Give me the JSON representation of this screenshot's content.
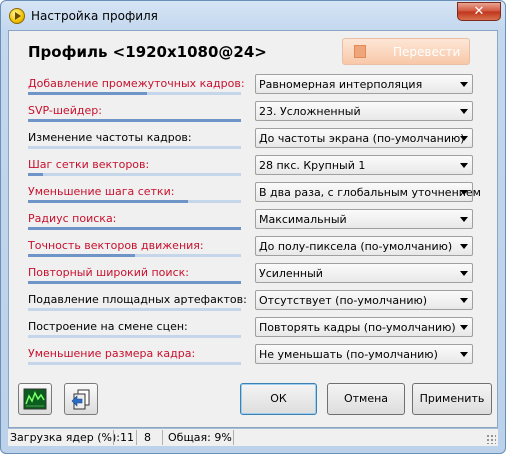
{
  "window": {
    "title": "Настройка профиля",
    "close_label": "✕"
  },
  "header": {
    "title": "Профиль <1920x1080@24>",
    "translate_label": "Перевести"
  },
  "settings": [
    {
      "label": "Добавление промежуточных кадров:",
      "value": "Равномерная интерполяция",
      "label_color": "red",
      "level": 0.56
    },
    {
      "label": "SVP-шейдер:",
      "value": "23. Усложненный",
      "label_color": "red",
      "level": 1.0
    },
    {
      "label": "Изменение частоты кадров:",
      "value": "До частоты экрана (по-умолчанию)",
      "label_color": "black",
      "level": 0.0
    },
    {
      "label": "Шаг сетки векторов:",
      "value": "28 пкс. Крупный 1",
      "label_color": "red",
      "level": 0.07
    },
    {
      "label": "Уменьшение шага сетки:",
      "value": "В два раза, с глобальным уточнением",
      "label_color": "red",
      "level": 0.75
    },
    {
      "label": "Радиус поиска:",
      "value": "Максимальный",
      "label_color": "red",
      "level": 1.0
    },
    {
      "label": "Точность векторов движения:",
      "value": "До полу-пиксела (по-умолчанию)",
      "label_color": "red",
      "level": 0.5
    },
    {
      "label": "Повторный широкий поиск:",
      "value": "Усиленный",
      "label_color": "red",
      "level": 1.0
    },
    {
      "label": "Подавление площадных артефактов:",
      "value": "Отсутствует (по-умолчанию)",
      "label_color": "black",
      "level": 0.0
    },
    {
      "label": "Построение на смене сцен:",
      "value": "Повторять кадры (по-умолчанию)",
      "label_color": "black",
      "level": 0.0
    },
    {
      "label": "Уменьшение размера кадра:",
      "value": "Не уменьшать (по-умолчанию)",
      "label_color": "red",
      "level": 0.0
    }
  ],
  "buttons": {
    "ok": "ОК",
    "cancel": "Отмена",
    "apply": "Применить",
    "icon_left": "graph-icon",
    "icon_right": "settings-copy-icon"
  },
  "status": {
    "cores_label": "Загрузка ядер (%):",
    "core1": "11",
    "core2": "8",
    "total": "Общая: 9%"
  },
  "colors": {
    "required_label": "#c8102e",
    "normal_label": "#000000",
    "level_fill": "#6f94c8",
    "level_track": "#c5d6ea",
    "translate_bg": "#f8c8a8"
  }
}
